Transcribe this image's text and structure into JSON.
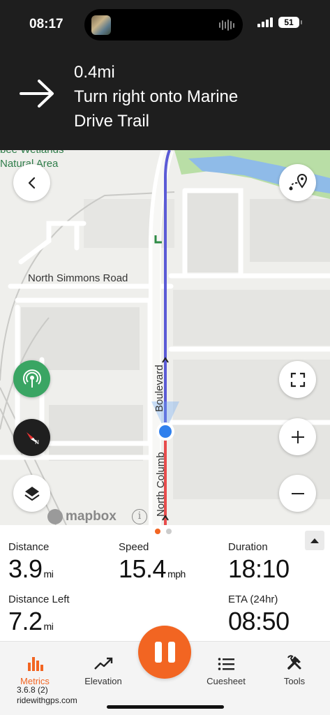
{
  "status_bar": {
    "time": "08:17",
    "battery": "51"
  },
  "navigation": {
    "distance": "0.4mi",
    "instruction_line1": "Turn right onto Marine",
    "instruction_line2": "Drive Trail",
    "maneuver_icon": "arrow-right-icon"
  },
  "map": {
    "area_label_line1": "bee Wetlands",
    "area_label_line2": "Natural Area",
    "road_1": "North Simmons Road",
    "road_2_part1": "North Columb",
    "road_2_part2": "Boulevard",
    "attribution": "mapbox",
    "info": "i",
    "buttons": [
      "back-button",
      "route-button",
      "location-button",
      "compass-button",
      "layers-button",
      "fullscreen-button",
      "zoom-in-button",
      "zoom-out-button"
    ]
  },
  "metrics": {
    "distance": {
      "label": "Distance",
      "value": "3.9",
      "unit": "mi"
    },
    "speed": {
      "label": "Speed",
      "value": "15.4",
      "unit": "mph"
    },
    "duration": {
      "label": "Duration",
      "value": "18:10"
    },
    "distance_left": {
      "label": "Distance Left",
      "value": "7.2",
      "unit": "mi"
    },
    "eta": {
      "label": "ETA (24hr)",
      "value": "08:50"
    }
  },
  "toolbar": {
    "metrics": "Metrics",
    "elevation": "Elevation",
    "cuesheet": "Cuesheet",
    "tools": "Tools",
    "version": "3.6.8 (2)",
    "site": "ridewithgps.com"
  },
  "colors": {
    "accent": "#f26522",
    "banner": "#1e1e1e",
    "route": "#5b5bd6",
    "locate": "#3aa563"
  }
}
